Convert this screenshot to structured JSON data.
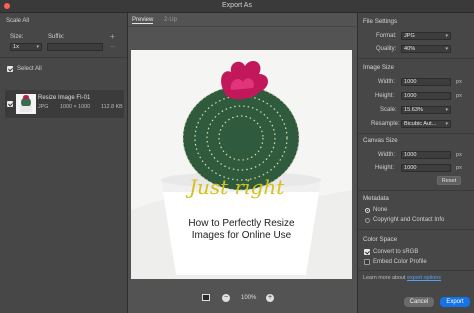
{
  "window": {
    "title": "Export As"
  },
  "left": {
    "scale_all": "Scale All",
    "size_label": "Size:",
    "suffix_label": "Suffix:",
    "scale_value": "1x",
    "add_symbol": "+",
    "remove_symbol": "−",
    "select_all": "Select All",
    "item": {
      "name": "Resize Image FI-01",
      "format": "JPG",
      "dimensions": "1000 × 1000",
      "filesize": "112.8 KB"
    }
  },
  "tabs": {
    "preview": "Preview",
    "two_up": "2-Up"
  },
  "preview": {
    "script_text": "Just right",
    "headline_1": "How to Perfectly Resize",
    "headline_2": "Images for Online Use",
    "zoom": "100%"
  },
  "settings": {
    "file_settings": "File Settings",
    "format_label": "Format:",
    "format_value": "JPG",
    "quality_label": "Quality:",
    "quality_value": "40%",
    "image_size": "Image Size",
    "width_label": "Width:",
    "width_value": "1000",
    "height_label": "Height:",
    "height_value": "1000",
    "px": "px",
    "scale_label": "Scale:",
    "scale_value": "15.63%",
    "resample_label": "Resample:",
    "resample_value": "Bicubic Aut...",
    "canvas_size": "Canvas Size",
    "canvas_width": "1000",
    "canvas_height": "1000",
    "reset": "Reset",
    "metadata": "Metadata",
    "meta_none": "None",
    "meta_copyright": "Copyright and Contact Info",
    "color_space": "Color Space",
    "convert_srgb": "Convert to sRGB",
    "embed_profile": "Embed Color Profile",
    "learn_more": "Learn more about",
    "export_options": "export options",
    "cancel": "Cancel",
    "export": "Export"
  }
}
